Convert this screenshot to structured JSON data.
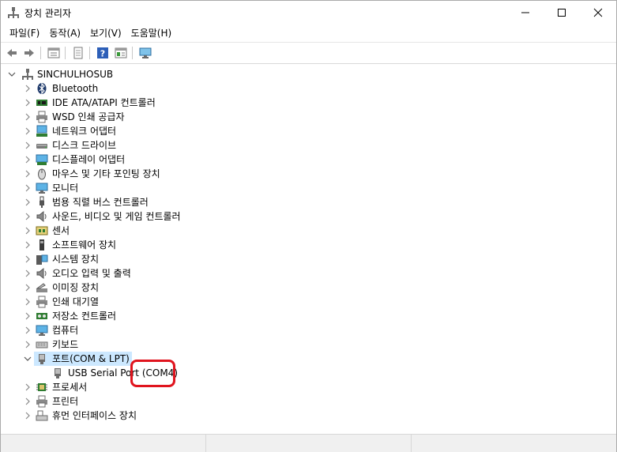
{
  "window": {
    "title": "장치 관리자",
    "minimize_icon": "minimize-icon",
    "maximize_icon": "maximize-icon",
    "close_icon": "close-icon"
  },
  "menu": {
    "items": [
      {
        "label": "파일(F)"
      },
      {
        "label": "동작(A)"
      },
      {
        "label": "보기(V)"
      },
      {
        "label": "도움말(H)"
      }
    ]
  },
  "toolbar": {
    "buttons": [
      "back-arrow-icon",
      "forward-arrow-icon",
      "properties-grid-icon",
      "document-icon",
      "help-icon",
      "action-grid-icon",
      "monitor-scan-icon"
    ]
  },
  "tree": {
    "root": {
      "label": "SINCHULHOSUB",
      "expanded": true
    },
    "items": [
      {
        "label": "Bluetooth",
        "icon": "bluetooth-icon"
      },
      {
        "label": "IDE ATA/ATAPI 컨트롤러",
        "icon": "ide-controller-icon"
      },
      {
        "label": "WSD 인쇄 공급자",
        "icon": "printer-icon"
      },
      {
        "label": "네트워크 어댑터",
        "icon": "network-adapter-icon"
      },
      {
        "label": "디스크 드라이브",
        "icon": "disk-drive-icon"
      },
      {
        "label": "디스플레이 어댑터",
        "icon": "display-adapter-icon"
      },
      {
        "label": "마우스 및 기타 포인팅 장치",
        "icon": "mouse-icon"
      },
      {
        "label": "모니터",
        "icon": "monitor-icon"
      },
      {
        "label": "범용 직렬 버스 컨트롤러",
        "icon": "usb-icon"
      },
      {
        "label": "사운드, 비디오 및 게임 컨트롤러",
        "icon": "speaker-icon"
      },
      {
        "label": "센서",
        "icon": "sensor-icon"
      },
      {
        "label": "소프트웨어 장치",
        "icon": "software-device-icon"
      },
      {
        "label": "시스템 장치",
        "icon": "system-device-icon"
      },
      {
        "label": "오디오 입력 및 출력",
        "icon": "audio-io-icon"
      },
      {
        "label": "이미징 장치",
        "icon": "imaging-device-icon"
      },
      {
        "label": "인쇄 대기열",
        "icon": "print-queue-icon"
      },
      {
        "label": "저장소 컨트롤러",
        "icon": "storage-controller-icon"
      },
      {
        "label": "컴퓨터",
        "icon": "computer-icon"
      },
      {
        "label": "키보드",
        "icon": "keyboard-icon"
      },
      {
        "label": "포트(COM & LPT)",
        "icon": "port-icon",
        "expanded": true,
        "selected": true,
        "children": [
          {
            "label": "USB Serial Port (COM4)",
            "icon": "port-icon"
          }
        ]
      },
      {
        "label": "프로세서",
        "icon": "processor-icon"
      },
      {
        "label": "프린터",
        "icon": "printer-icon"
      },
      {
        "label": "휴먼 인터페이스 장치",
        "icon": "hid-icon"
      }
    ]
  },
  "annotation": {
    "color": "#e0141e"
  },
  "colors": {
    "selection": "#cce8ff"
  }
}
